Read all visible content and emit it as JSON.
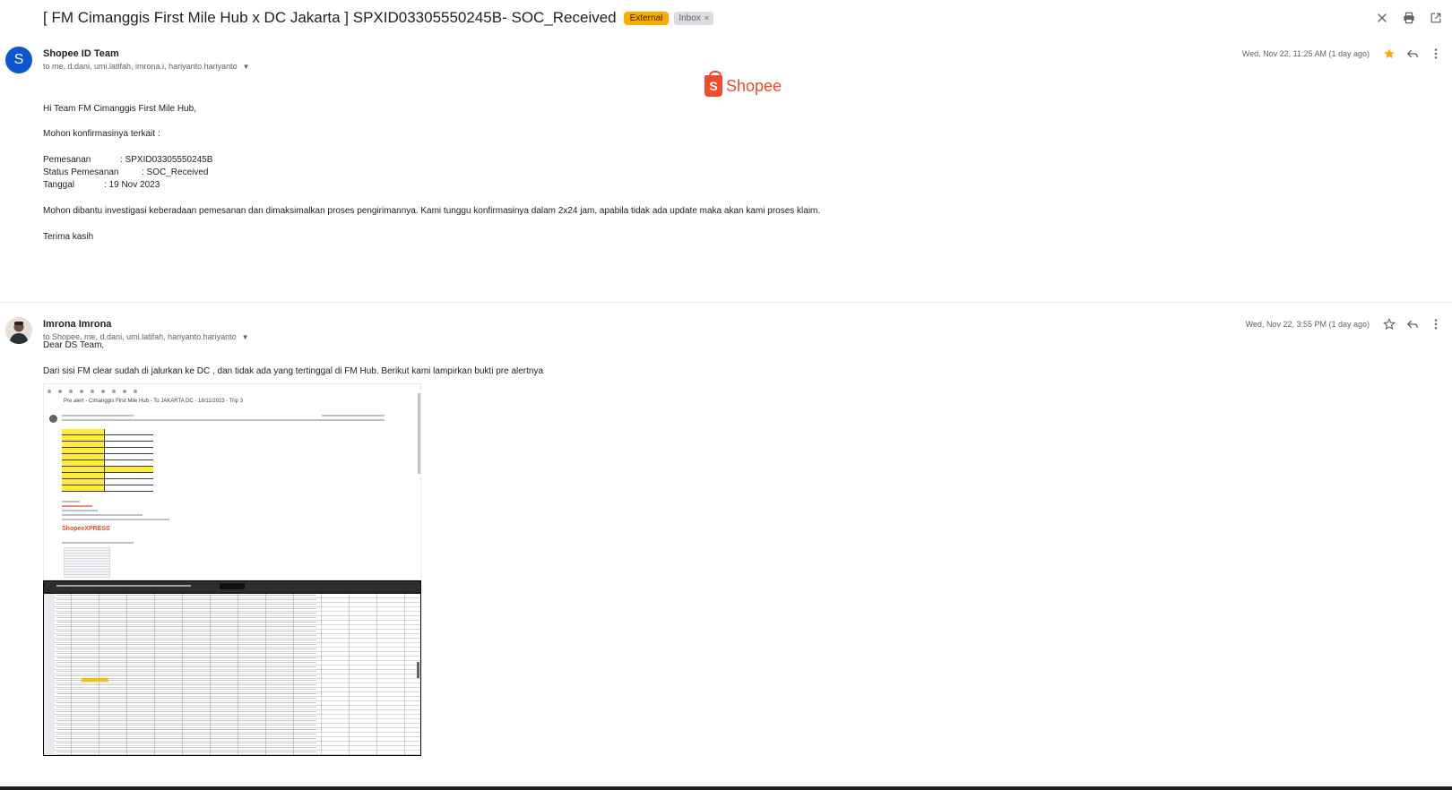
{
  "thread": {
    "subject": "[ FM Cimanggis First Mile Hub x DC Jakarta ] SPXID03305550245B- SOC_Received",
    "badge_external": "External",
    "badge_inbox": "Inbox",
    "badge_inbox_close": "×"
  },
  "messages": [
    {
      "avatar_letter": "S",
      "sender": "Shopee ID Team",
      "recipients": "to me, d.dani, umi.latifah, imrona.i, hariyanto.hariyanto",
      "date": "Wed, Nov 22, 11:25 AM (1 day ago)",
      "starred": true,
      "logo_text": "Shopee",
      "logo_letter": "S",
      "greeting": "Hi Team FM Cimanggis First Mile Hub,",
      "intro": "Mohon konfirmasinya terkait :",
      "fields": [
        {
          "key": "Pemesanan",
          "value": ": SPXID03305550245B"
        },
        {
          "key": "Status Pemesanan",
          "value": ": SOC_Received"
        },
        {
          "key": "Tanggal",
          "value": ": 19 Nov 2023"
        }
      ],
      "body": "Mohon dibantu investigasi keberadaan pemesanan dan dimaksimalkan proses pengirimannya. Kami tunggu konfirmasinya dalam 2x24 jam, apabila tidak ada update maka akan kami proses klaim.",
      "closing": "Terima kasih"
    },
    {
      "sender": "Imrona Imrona",
      "recipients": "to Shopee, me, d.dani, umi.latifah, hariyanto.hariyanto",
      "date": "Wed, Nov 22, 3:55 PM (1 day ago)",
      "starred": false,
      "greeting": "Dear DS Team,",
      "body": "Dari sisi FM clear sudah di jalurkan ke DC , dan tidak ada yang tertinggal di FM Hub. Berikut kami lampirkan bukti pre alertnya",
      "embedded_title": "Pre alert - Cimanggis First Mile Hub - To JAKARTA DC - 18/11/2023 - Trip 3",
      "embedded_brand": "ShopeeXPRESS"
    }
  ],
  "icons": {
    "close": "close-icon",
    "print": "print-icon",
    "open_new": "open-in-new-icon",
    "star": "star-icon",
    "reply": "reply-icon",
    "more": "more-vert-icon"
  },
  "colors": {
    "external_badge": "#f9ab00",
    "shopee_orange": "#ee4d2d",
    "avatar_blue": "#0b57d0"
  }
}
